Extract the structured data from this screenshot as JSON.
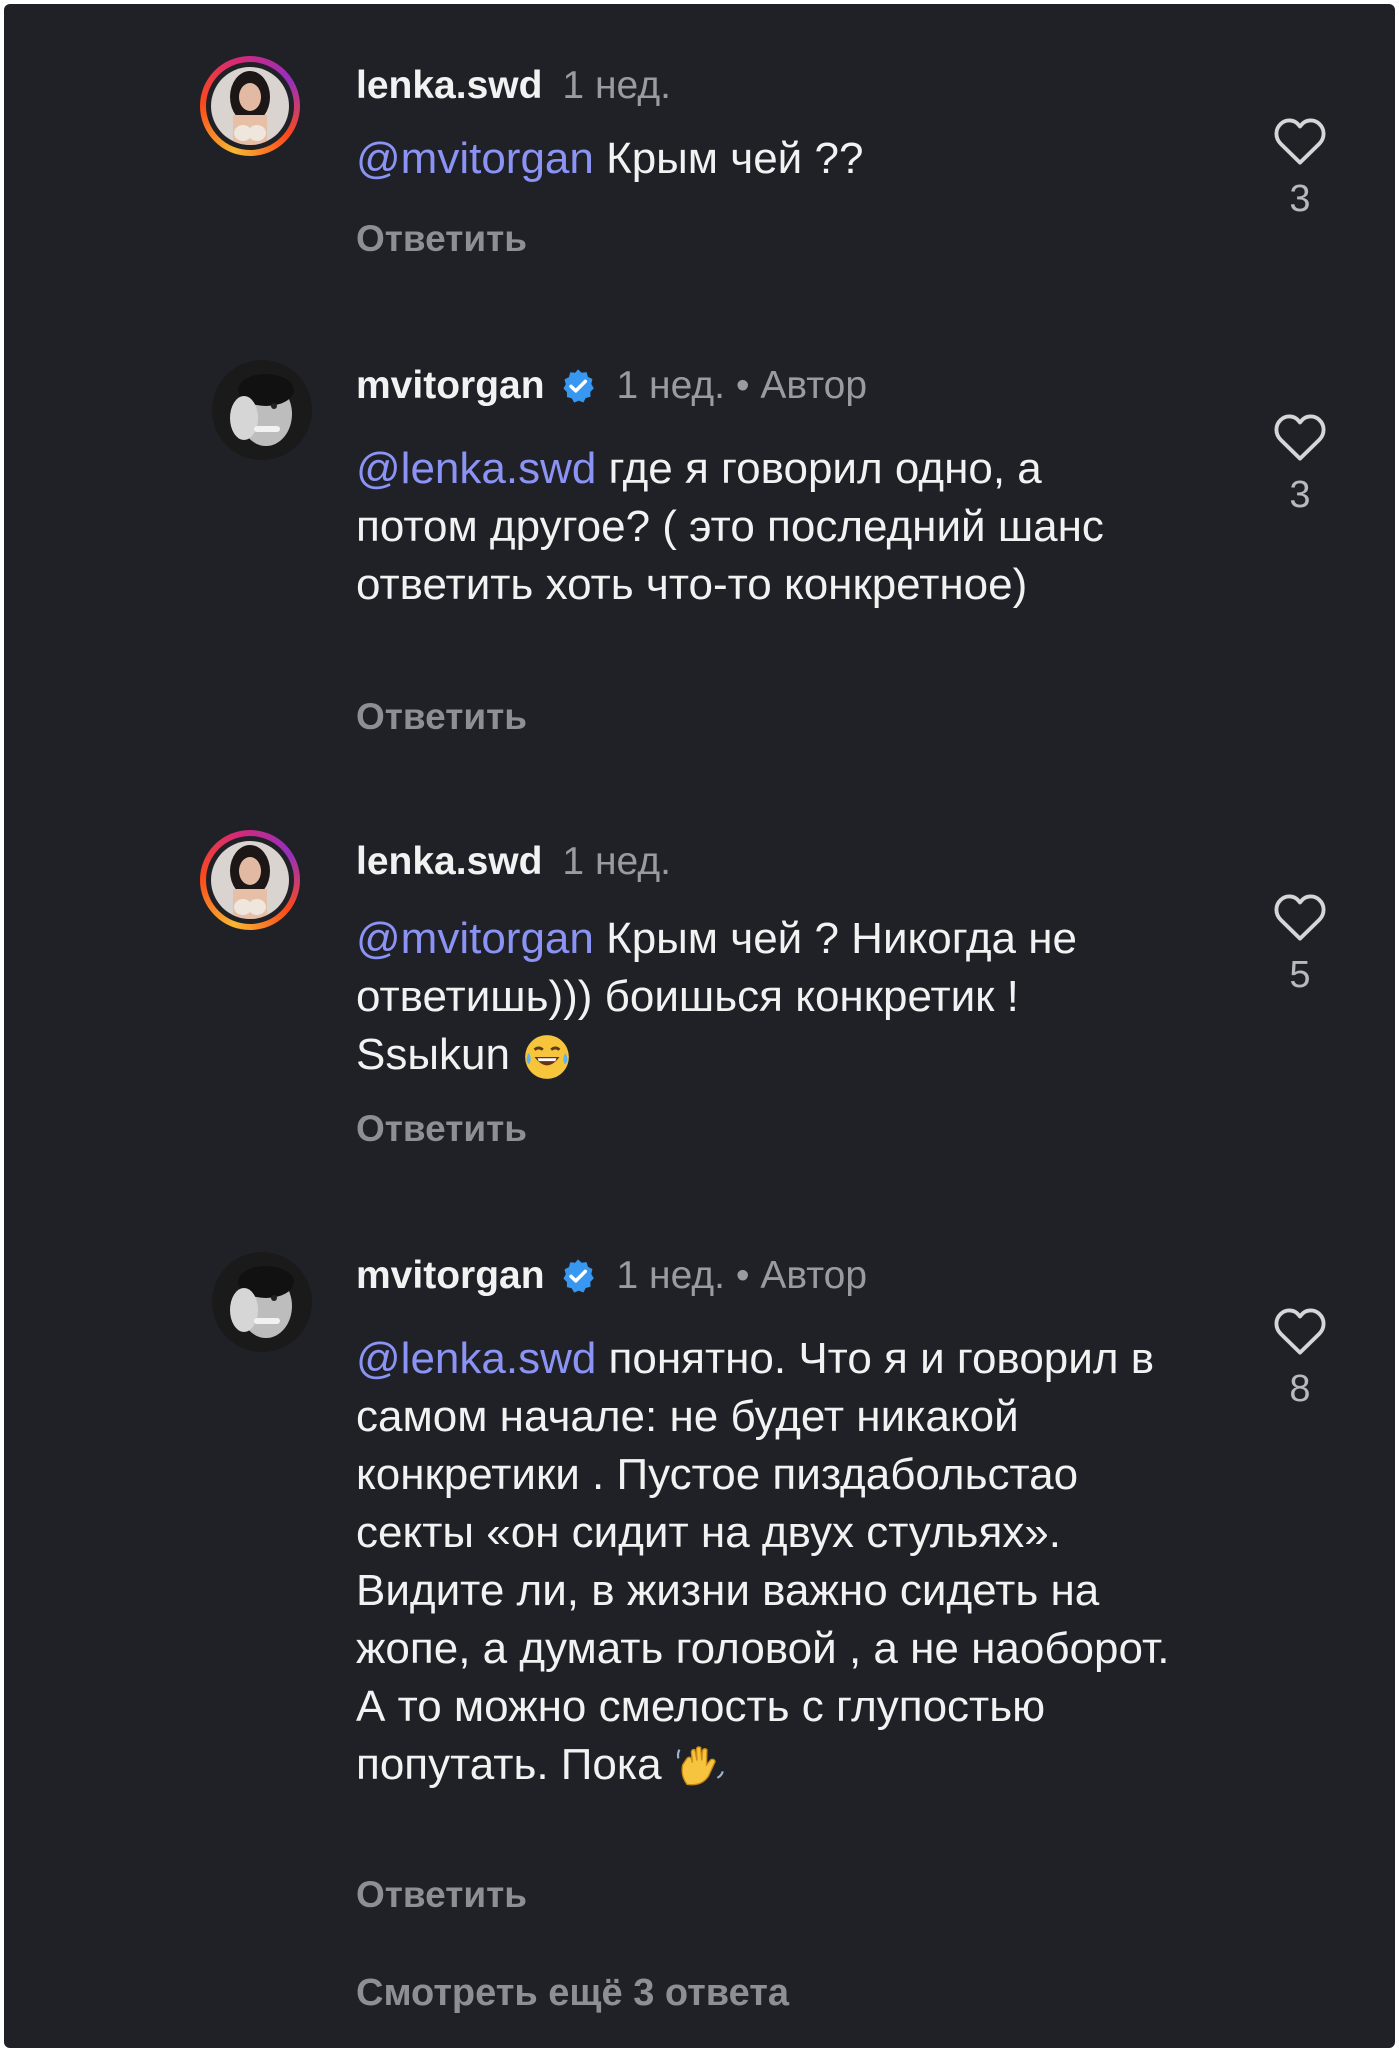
{
  "comments": [
    {
      "username": "lenka.swd",
      "time": "1 нед.",
      "author_badge": "",
      "mention": "@mvitorgan",
      "text": " Крым чей ??",
      "reply_label": "Ответить",
      "likes": "3"
    },
    {
      "username": "mvitorgan",
      "time": "1 нед. • Автор",
      "mention": "@lenka.swd",
      "text": " где я говорил одно, а потом другое? ( это последний шанс ответить хоть что-то конкретное)",
      "reply_label": "Ответить",
      "likes": "3"
    },
    {
      "username": "lenka.swd",
      "time": "1 нед.",
      "mention": "@mvitorgan",
      "text": " Крым чей ? Никогда не ответишь))) боишься конкретик ! Ssыkun",
      "reply_label": "Ответить",
      "likes": "5"
    },
    {
      "username": "mvitorgan",
      "time": "1 нед. • Автор",
      "mention": "@lenka.swd",
      "text": " понятно. Что я и говорил в самом начале: не будет никакой конкретики . Пустое пиздабольстао секты «он сидит на двух стульях». Видите ли, в жизни важно сидеть на жопе, а думать головой , а не наоборот. А то можно смелость с глупостью попутать. Пока",
      "reply_label": "Ответить",
      "likes": "8"
    }
  ],
  "view_more": "Смотреть ещё 3 ответа",
  "colors": {
    "background": "#202126",
    "mention": "#8b94f5",
    "verified": "#3897f0",
    "muted": "#8e8f94"
  },
  "icons": {
    "like": "heart-outline-icon",
    "verified": "verified-badge-icon",
    "emoji_laugh": "tears-of-joy-emoji",
    "emoji_wave": "waving-hand-emoji"
  }
}
